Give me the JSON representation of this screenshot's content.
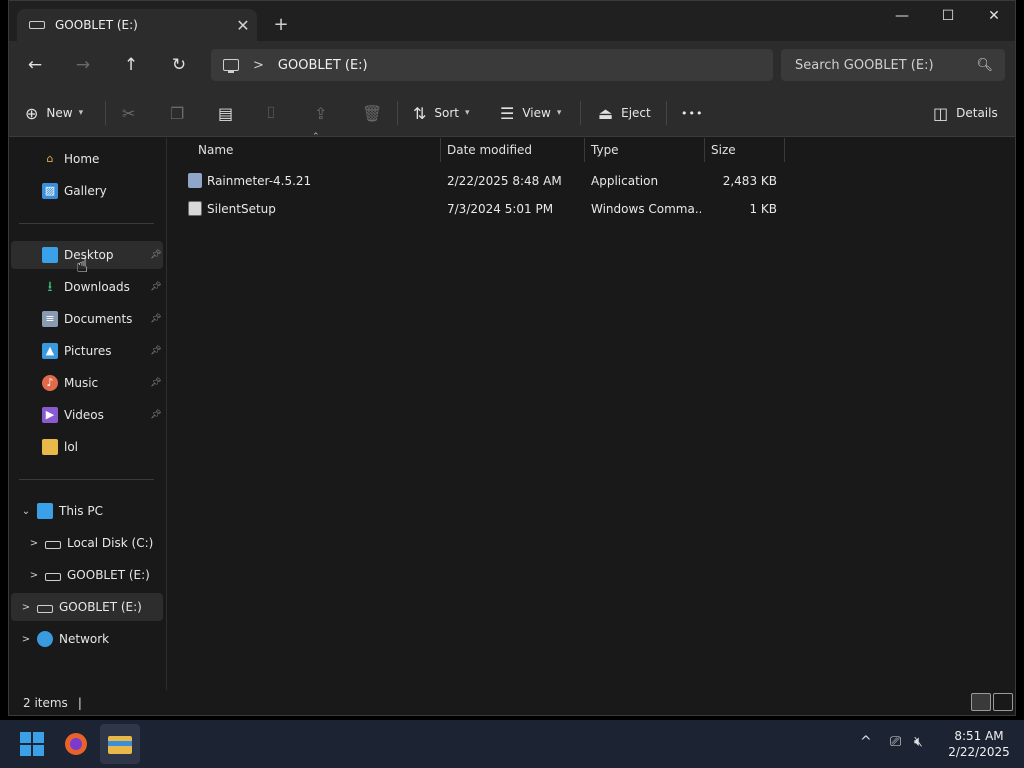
{
  "window": {
    "tab_title": "GOOBLET (E:)",
    "tab_close": "✕",
    "new_tab": "+",
    "minimize": "—",
    "maximize": "☐",
    "close": "✕"
  },
  "addressbar": {
    "back": "←",
    "forward": "→",
    "up": "↑",
    "refresh": "↻",
    "breadcrumb_separator": ">",
    "breadcrumb": "GOOBLET (E:)",
    "search_placeholder": "Search GOOBLET (E:)"
  },
  "commandbar": {
    "new_label": "New",
    "sort_label": "Sort",
    "view_label": "View",
    "eject_label": "Eject",
    "more": "•••",
    "details_label": "Details"
  },
  "sidebar": {
    "top": [
      {
        "label": "Home",
        "icon": "home-icon",
        "color": "#e6a75a"
      },
      {
        "label": "Gallery",
        "icon": "gallery-icon",
        "color": "#4aa0e0"
      }
    ],
    "pinned": [
      {
        "label": "Desktop",
        "icon": "desktop-icon",
        "color": "#3aa0e8",
        "selected": true
      },
      {
        "label": "Downloads",
        "icon": "download-icon",
        "color": "#3ac07a"
      },
      {
        "label": "Documents",
        "icon": "documents-icon",
        "color": "#8a9ab0"
      },
      {
        "label": "Pictures",
        "icon": "pictures-icon",
        "color": "#3a9ae0"
      },
      {
        "label": "Music",
        "icon": "music-icon",
        "color": "#e06a4a"
      },
      {
        "label": "Videos",
        "icon": "videos-icon",
        "color": "#8a5ad0"
      },
      {
        "label": "lol",
        "icon": "folder-icon",
        "color": "#e8b84a"
      }
    ],
    "tree": [
      {
        "label": "This PC",
        "expander": "⌄"
      },
      {
        "label": "Local Disk (C:)",
        "expander": ">"
      },
      {
        "label": "GOOBLET (E:)",
        "expander": ">"
      },
      {
        "label": "GOOBLET (E:)",
        "expander": ">"
      },
      {
        "label": "Network",
        "expander": ">"
      }
    ]
  },
  "filelist": {
    "columns": {
      "name": "Name",
      "date": "Date modified",
      "type": "Type",
      "size": "Size"
    },
    "files": [
      {
        "name": "Rainmeter-4.5.21",
        "date": "2/22/2025 8:48 AM",
        "type": "Application",
        "size": "2,483 KB",
        "icon": "installer-icon"
      },
      {
        "name": "SilentSetup",
        "date": "7/3/2024 5:01 PM",
        "type": "Windows Comma...",
        "size": "1 KB",
        "icon": "batch-file-icon"
      }
    ]
  },
  "status": {
    "item_count": "2 items",
    "separator": "|"
  },
  "taskbar": {
    "time": "8:51 AM",
    "date": "2/22/2025",
    "tray_chevron": "^"
  },
  "colors": {
    "accent": "#0078d4",
    "window_bg": "#191919",
    "taskbar_bg": "#1c2434"
  }
}
